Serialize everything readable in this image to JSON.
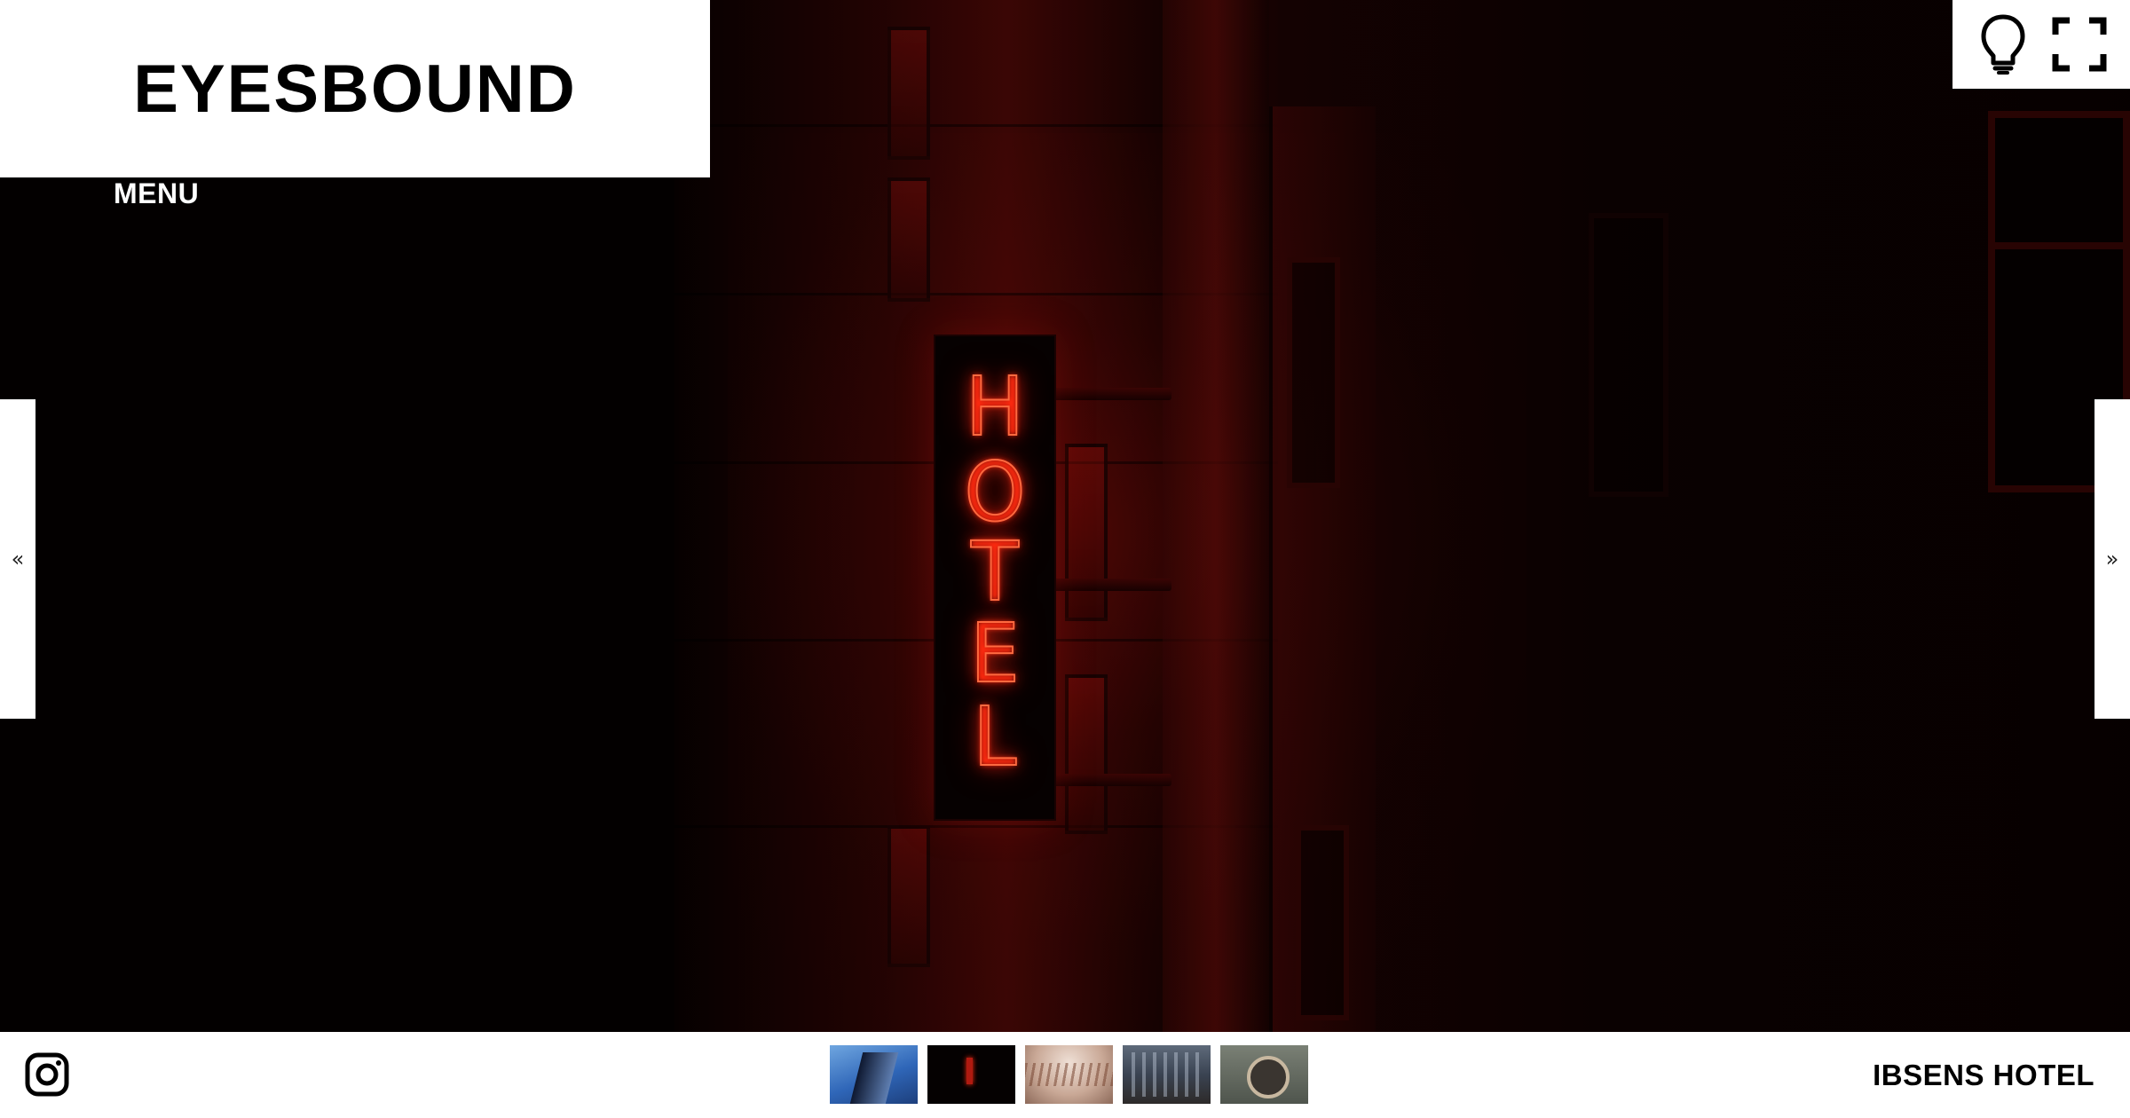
{
  "brand": {
    "title": "EYESBOUND"
  },
  "nav": {
    "menu_label": "MENU",
    "prev_label": "«",
    "next_label": "»"
  },
  "top_controls": {
    "lightbulb_icon": "lightbulb-icon",
    "fullscreen_icon": "fullscreen-icon"
  },
  "slide": {
    "sign_letters": [
      "H",
      "O",
      "T",
      "E",
      "L"
    ],
    "caption": "IBSENS HOTEL"
  },
  "footer": {
    "social_icon": "instagram-icon",
    "thumbnails": [
      {
        "name": "thumbnail-1"
      },
      {
        "name": "thumbnail-2"
      },
      {
        "name": "thumbnail-3"
      },
      {
        "name": "thumbnail-4"
      },
      {
        "name": "thumbnail-5"
      }
    ]
  },
  "colors": {
    "background": "#000000",
    "panel": "#ffffff",
    "neon": "#ff3b1f",
    "text_dark": "#000000",
    "text_light": "#ffffff"
  }
}
